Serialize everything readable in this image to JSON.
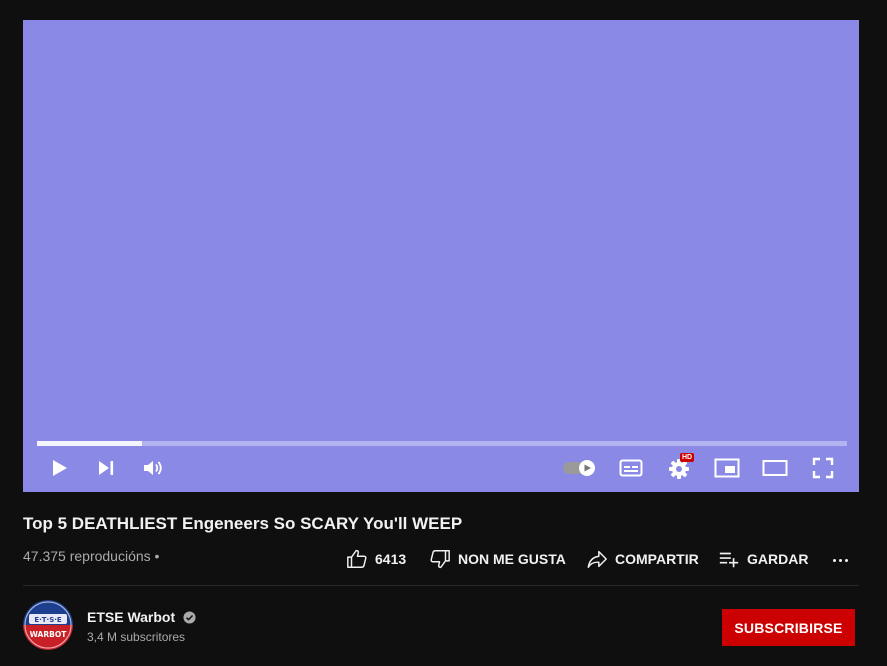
{
  "player": {
    "background_color": "#8a8ae6",
    "progress_fraction": 0.13,
    "quality_badge": "HD",
    "controls": [
      "play-icon",
      "next-icon",
      "volume-icon",
      "autoplay-toggle-icon",
      "subtitles-icon",
      "settings-icon",
      "miniplayer-icon",
      "theater-mode-icon",
      "fullscreen-icon"
    ]
  },
  "video": {
    "title": "Top 5 DEATHLIEST Engeneers So SCARY You'll WEEP",
    "views": "47.375 reproducións •"
  },
  "actions": {
    "like_count": "6413",
    "dislike_label": "NON ME GUSTA",
    "share_label": "COMPARTIR",
    "save_label": "GARDAR"
  },
  "channel": {
    "name": "ETSE Warbot",
    "subscribers": "3,4 M subscritores",
    "avatar_text_top": "E·T·S·E",
    "avatar_text_bottom": "WARBOT",
    "subscribe_label": "SUBSCRIBIRSE",
    "subscribe_color": "#cc0000"
  }
}
